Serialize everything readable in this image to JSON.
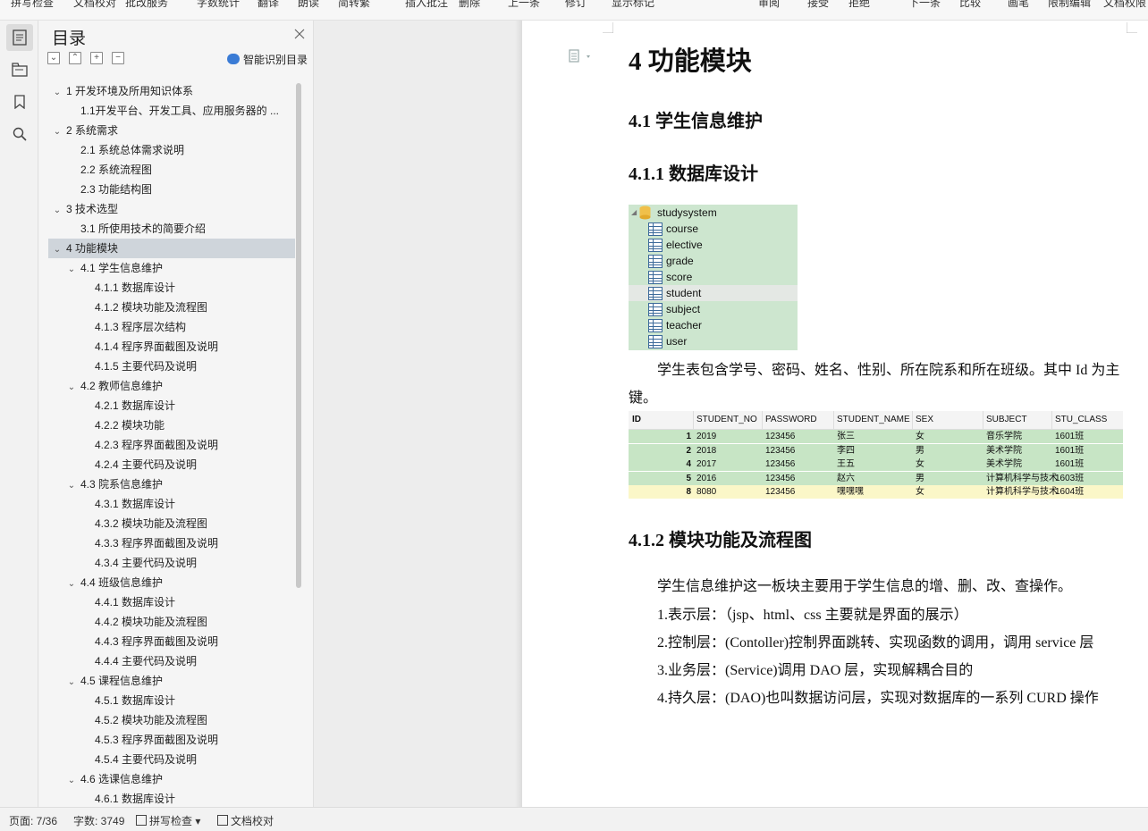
{
  "ribbon": {
    "items": [
      "拼写检查",
      "文档校对",
      "批改服务",
      "字数统计",
      "翻译",
      "朗读",
      "简转繁",
      "插入批注",
      "删除",
      "上一条",
      "修订",
      "显示标记",
      "审阅",
      "接受",
      "拒绝",
      "下一条",
      "比较",
      "画笔",
      "限制编辑",
      "文档权限"
    ]
  },
  "sidebar": {
    "title": "目录",
    "smart_label": "智能识别目录",
    "toc": [
      {
        "text": "1  开发环境及所用知识体系",
        "level": 1,
        "expanded": true
      },
      {
        "text": "1.1开发平台、开发工具、应用服务器的 ...",
        "level": 2
      },
      {
        "text": "2  系统需求",
        "level": 1,
        "expanded": true
      },
      {
        "text": "2.1  系统总体需求说明",
        "level": 2
      },
      {
        "text": "2.2  系统流程图",
        "level": 2
      },
      {
        "text": "2.3  功能结构图",
        "level": 2
      },
      {
        "text": "3  技术选型",
        "level": 1,
        "expanded": true
      },
      {
        "text": "3.1  所使用技术的简要介绍",
        "level": 2
      },
      {
        "text": "4  功能模块",
        "level": 1,
        "expanded": true,
        "selected": true
      },
      {
        "text": "4.1  学生信息维护",
        "level": 2,
        "expanded": true
      },
      {
        "text": "4.1.1  数据库设计",
        "level": 3
      },
      {
        "text": "4.1.2  模块功能及流程图",
        "level": 3
      },
      {
        "text": "4.1.3  程序层次结构",
        "level": 3
      },
      {
        "text": "4.1.4  程序界面截图及说明",
        "level": 3
      },
      {
        "text": "4.1.5  主要代码及说明",
        "level": 3
      },
      {
        "text": "4.2  教师信息维护",
        "level": 2,
        "expanded": true
      },
      {
        "text": "4.2.1  数据库设计",
        "level": 3
      },
      {
        "text": "4.2.2  模块功能",
        "level": 3
      },
      {
        "text": "4.2.3  程序界面截图及说明",
        "level": 3
      },
      {
        "text": "4.2.4  主要代码及说明",
        "level": 3
      },
      {
        "text": "4.3  院系信息维护",
        "level": 2,
        "expanded": true
      },
      {
        "text": "4.3.1  数据库设计",
        "level": 3
      },
      {
        "text": "4.3.2 模块功能及流程图",
        "level": 3
      },
      {
        "text": "4.3.3  程序界面截图及说明",
        "level": 3
      },
      {
        "text": "4.3.4 主要代码及说明",
        "level": 3
      },
      {
        "text": "4.4  班级信息维护",
        "level": 2,
        "expanded": true
      },
      {
        "text": "4.4.1  数据库设计",
        "level": 3
      },
      {
        "text": "4.4.2  模块功能及流程图",
        "level": 3
      },
      {
        "text": "4.4.3 程序界面截图及说明",
        "level": 3
      },
      {
        "text": "4.4.4 主要代码及说明",
        "level": 3
      },
      {
        "text": "4.5  课程信息维护",
        "level": 2,
        "expanded": true
      },
      {
        "text": "4.5.1  数据库设计",
        "level": 3
      },
      {
        "text": "4.5.2  模块功能及流程图",
        "level": 3
      },
      {
        "text": "4.5.3 程序界面截图及说明",
        "level": 3
      },
      {
        "text": "4.5.4 主要代码及说明",
        "level": 3
      },
      {
        "text": "4.6  选课信息维护",
        "level": 2,
        "expanded": true
      },
      {
        "text": "4.6.1  数据库设计",
        "level": 3
      }
    ]
  },
  "document": {
    "h1": "4  功能模块",
    "h2": "4.1  学生信息维护",
    "h3a": "4.1.1  数据库设计",
    "db": {
      "name": "studysystem",
      "tables": [
        "course",
        "elective",
        "grade",
        "score",
        "student",
        "subject",
        "teacher",
        "user"
      ],
      "selected": "student"
    },
    "para1_line1": "学生表包含学号、密码、姓名、性别、所在院系和所在班级。其中 Id 为主",
    "para1_line2": "键。",
    "grid": {
      "columns": [
        "ID",
        "STUDENT_NO",
        "PASSWORD",
        "STUDENT_NAME",
        "SEX",
        "SUBJECT",
        "STU_CLASS"
      ],
      "rows": [
        [
          "1",
          "2019",
          "123456",
          "张三",
          "女",
          "音乐学院",
          "1601班"
        ],
        [
          "2",
          "2018",
          "123456",
          "李四",
          "男",
          "美术学院",
          "1601班"
        ],
        [
          "4",
          "2017",
          "123456",
          "王五",
          "女",
          "美术学院",
          "1601班"
        ],
        [
          "5",
          "2016",
          "123456",
          "赵六",
          "男",
          "计算机科学与技术",
          "1603班"
        ],
        [
          "8",
          "8080",
          "123456",
          "嘿嘿嘿",
          "女",
          "计算机科学与技术",
          "1604班"
        ]
      ]
    },
    "h3b": "4.1.2  模块功能及流程图",
    "para2": "学生信息维护这一板块主要用于学生信息的增、删、改、查操作。",
    "list": [
      "1.表示层：（jsp、html、css  主要就是界面的展示）",
      "2.控制层：(Contoller)控制界面跳转、实现函数的调用，调用 service 层",
      "3.业务层：(Service)调用 DAO 层，实现解耦合目的",
      "4.持久层：(DAO)也叫数据访问层，实现对数据库的一系列 CURD 操作"
    ]
  },
  "status": {
    "page": "页面: 7/36",
    "words": "字数: 3749",
    "spell": "拼写检查",
    "proof": "文档校对"
  },
  "colors": {
    "db_bg": "#cde6cf",
    "grid_green": "#c7e5c5",
    "grid_yellow": "#fbf7c8",
    "toc_selected": "#cfd5db"
  }
}
